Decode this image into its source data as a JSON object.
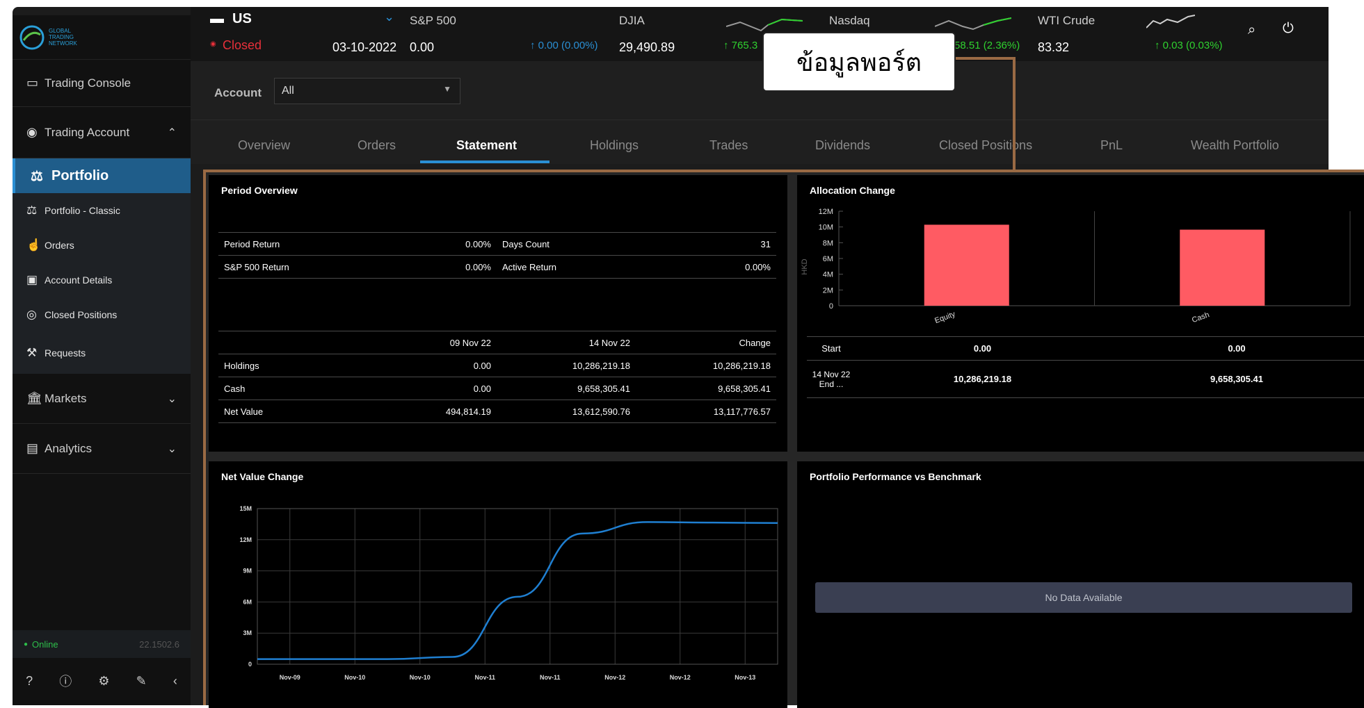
{
  "sidebar": {
    "logo_text": "GLOBAL TRADING NETWORK",
    "trading_console": "Trading Console",
    "trading_account": "Trading Account",
    "portfolio": "Portfolio",
    "sub_items": [
      "Portfolio - Classic",
      "Orders",
      "Account Details",
      "Closed Positions",
      "Requests"
    ],
    "markets": "Markets",
    "analytics": "Analytics",
    "status": "Online",
    "version": "22.1502.6"
  },
  "ticker": {
    "market": "US",
    "status": "Closed",
    "date": "03-10-2022",
    "sp500_name": "S&P 500",
    "sp500_value": "0.00",
    "sp500_change": "↑ 0.00 (0.00%)",
    "djia_name": "DJIA",
    "djia_value": "29,490.89",
    "djia_change": "↑ 765.3",
    "nasdaq_name": "Nasdaq",
    "nasdaq_change": "58.51 (2.36%)",
    "wti_name": "WTI Crude",
    "wti_value": "83.32",
    "wti_change": "↑ 0.03 (0.03%)"
  },
  "account": {
    "label": "Account",
    "value": "All"
  },
  "tabs": [
    "Overview",
    "Orders",
    "Statement",
    "Holdings",
    "Trades",
    "Dividends",
    "Closed Positions",
    "PnL",
    "Wealth Portfolio"
  ],
  "callout": "ข้อมูลพอร์ต",
  "period_overview": {
    "title": "Period Overview",
    "rows": [
      [
        "Period Return",
        "0.00%",
        "Days Count",
        "31"
      ],
      [
        "S&P 500 Return",
        "0.00%",
        "Active Return",
        "0.00%"
      ]
    ],
    "headers": [
      "",
      "09 Nov 22",
      "14 Nov 22",
      "Change"
    ],
    "values": [
      [
        "Holdings",
        "0.00",
        "10,286,219.18",
        "10,286,219.18"
      ],
      [
        "Cash",
        "0.00",
        "9,658,305.41",
        "9,658,305.41"
      ],
      [
        "Net Value",
        "494,814.19",
        "13,612,590.76",
        "13,117,776.57"
      ]
    ]
  },
  "allocation": {
    "title": "Allocation Change",
    "table": [
      [
        "Start",
        "0.00",
        "0.00"
      ],
      [
        "14 Nov 22 End ...",
        "10,286,219.18",
        "9,658,305.41"
      ]
    ]
  },
  "net_value": {
    "title": "Net Value Change"
  },
  "performance": {
    "title": "Portfolio Performance vs Benchmark",
    "no_data": "No Data Available"
  },
  "chart_data": [
    {
      "type": "bar",
      "title": "Allocation Change",
      "ylabel": "HKD",
      "categories": [
        "Equity",
        "Cash"
      ],
      "values": [
        10286219.18,
        9658305.41
      ],
      "yticks": [
        "0",
        "2M",
        "4M",
        "6M",
        "8M",
        "10M",
        "12M"
      ],
      "ylim": [
        0,
        12000000
      ],
      "colors": {
        "bar": "#ff5b63"
      }
    },
    {
      "type": "line",
      "title": "Net Value Change",
      "x": [
        "Nov-09",
        "Nov-10",
        "Nov-10",
        "Nov-11",
        "Nov-11",
        "Nov-12",
        "Nov-12",
        "Nov-13"
      ],
      "yticks": [
        "0",
        "3M",
        "6M",
        "9M",
        "12M",
        "15M"
      ],
      "ylim": [
        0,
        15000000
      ],
      "series": [
        {
          "values": [
            494814,
            494814,
            494814,
            700000,
            6500000,
            12600000,
            13700000,
            13650000,
            13612590
          ]
        }
      ],
      "colors": {
        "line": "#1f7fd1"
      }
    }
  ]
}
